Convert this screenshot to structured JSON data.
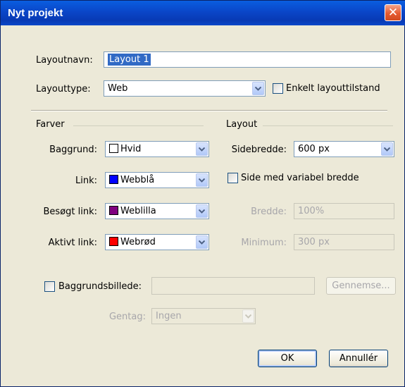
{
  "window": {
    "title": "Nyt projekt",
    "close_glyph": "✕"
  },
  "layout_name": {
    "label": "Layoutnavn:",
    "value": "Layout 1"
  },
  "layout_type": {
    "label": "Layouttype:",
    "value": "Web",
    "checkbox_label": "Enkelt layouttilstand",
    "checkbox_checked": false
  },
  "colors": {
    "group_label": "Farver",
    "background": {
      "label": "Baggrund:",
      "value": "Hvid",
      "swatch": "#ffffff"
    },
    "link": {
      "label": "Link:",
      "value": "Webblå",
      "swatch": "#0000ff"
    },
    "visited_link": {
      "label": "Besøgt link:",
      "value": "Weblilla",
      "swatch": "#800080"
    },
    "active_link": {
      "label": "Aktivt link:",
      "value": "Webrød",
      "swatch": "#ff0000"
    }
  },
  "layout": {
    "group_label": "Layout",
    "page_width": {
      "label": "Sidebredde:",
      "value": "600 px"
    },
    "variable_width": {
      "label": "Side med variabel bredde",
      "checked": false
    },
    "width": {
      "label": "Bredde:",
      "value": "100%"
    },
    "minimum": {
      "label": "Minimum:",
      "value": "300 px"
    }
  },
  "background_image": {
    "label": "Baggrundsbillede:",
    "checked": false,
    "path": "",
    "browse_label": "Gennemse..."
  },
  "repeat": {
    "label": "Gentag:",
    "value": "Ingen"
  },
  "buttons": {
    "ok": "OK",
    "cancel": "Annullér"
  },
  "colors_theme": {
    "title_bar": "#0a46c8",
    "dialog_bg": "#ece9d8",
    "close_button": "#e65a30",
    "selection": "#316ac5"
  }
}
